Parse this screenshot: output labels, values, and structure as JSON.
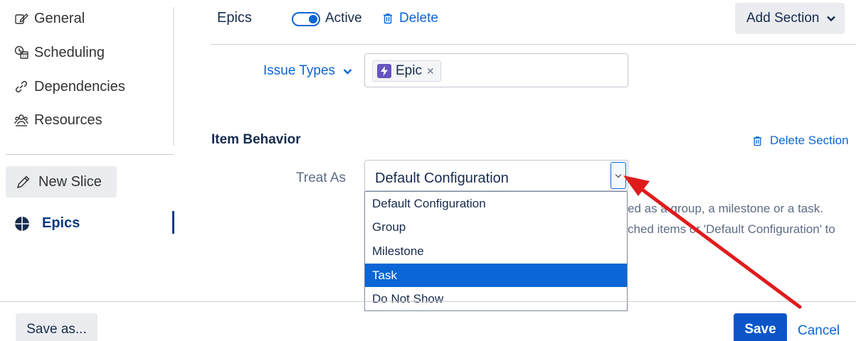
{
  "sidebar": {
    "items": [
      {
        "label": "General",
        "icon": "settings-edit-icon"
      },
      {
        "label": "Scheduling",
        "icon": "calendar-clock-icon"
      },
      {
        "label": "Dependencies",
        "icon": "link-icon"
      },
      {
        "label": "Resources",
        "icon": "people-icon"
      }
    ],
    "new_slice": "New Slice",
    "active_item": "Epics"
  },
  "header": {
    "title": "Epics",
    "toggle_label": "Active",
    "toggle_on": true,
    "delete_label": "Delete",
    "add_section_label": "Add Section"
  },
  "issue_types": {
    "label": "Issue Types",
    "chips": [
      {
        "label": "Epic",
        "icon": "epic-bolt-icon"
      }
    ]
  },
  "item_behavior": {
    "title": "Item Behavior",
    "delete_section_label": "Delete Section",
    "treat_as_label": "Treat As",
    "selected": "Default Configuration",
    "options": [
      "Default Configuration",
      "Group",
      "Milestone",
      "Task",
      "Do Not Show"
    ],
    "highlighted_option": "Task",
    "help_line1": "ed as a group, a milestone or a task.",
    "help_line2": "ched items or 'Default Configuration' to"
  },
  "footer": {
    "save_as_label": "Save as...",
    "save_label": "Save",
    "cancel_label": "Cancel"
  },
  "colors": {
    "primary": "#0b66d6",
    "save_button": "#0b55c9",
    "active_nav": "#0b3a82",
    "epic_icon": "#6554c0",
    "annotation_arrow": "#e01b1b"
  }
}
